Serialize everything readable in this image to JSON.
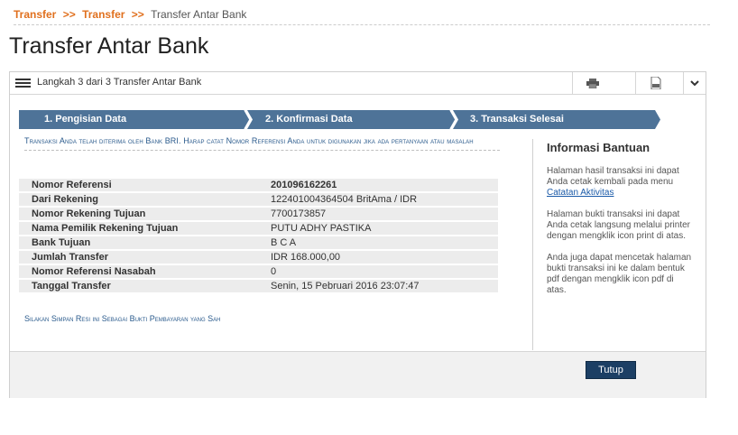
{
  "breadcrumb": {
    "items": [
      "Transfer",
      "Transfer"
    ],
    "separator": ">>",
    "current": "Transfer Antar Bank"
  },
  "page_title": "Transfer Antar Bank",
  "panel": {
    "step_text": "Langkah 3 dari 3 Transfer Antar Bank",
    "icons": {
      "print": "printer-icon",
      "pdf": "pdf-icon",
      "dropdown": "chevron-down-icon"
    }
  },
  "steps": [
    {
      "label": "1. Pengisian Data"
    },
    {
      "label": "2. Konfirmasi Data"
    },
    {
      "label": "3. Transaksi Selesai"
    }
  ],
  "notice": "Transaksi Anda telah diterima oleh Bank BRI. Harap catat Nomor Referensi Anda untuk digunakan jika ada pertanyaan atau masalah",
  "details": [
    {
      "label": "Nomor Referensi",
      "value": "201096162261"
    },
    {
      "label": "Dari Rekening",
      "value": "122401004364504 BritAma / IDR"
    },
    {
      "label": "Nomor Rekening Tujuan",
      "value": "7700173857"
    },
    {
      "label": "Nama Pemilik Rekening Tujuan",
      "value": "PUTU ADHY PASTIKA"
    },
    {
      "label": "Bank Tujuan",
      "value": "B C A"
    },
    {
      "label": "Jumlah Transfer",
      "value": "IDR 168.000,00"
    },
    {
      "label": "Nomor Referensi Nasabah",
      "value": "0"
    },
    {
      "label": "Tanggal Transfer",
      "value": "Senin, 15 Pebruari 2016 23:07:47"
    }
  ],
  "save_note": "Silakan Simpan Resi ini Sebagai Bukti Pembayaran yang Sah",
  "help": {
    "title": "Informasi Bantuan",
    "p1_before": "Halaman hasil transaksi ini dapat Anda cetak kembali pada menu ",
    "p1_link": "Catatan Aktivitas",
    "p2": "Halaman bukti transaksi ini dapat Anda cetak langsung melalui printer dengan mengklik icon print di atas.",
    "p3": "Anda juga dapat mencetak halaman bukti transaksi ini ke dalam bentuk pdf dengan mengklik icon pdf di atas."
  },
  "footer": {
    "close_label": "Tutup"
  },
  "colors": {
    "accent": "#e0701e",
    "step_bar": "#4e7398",
    "link": "#1a5aa8",
    "button": "#1c3f64"
  }
}
